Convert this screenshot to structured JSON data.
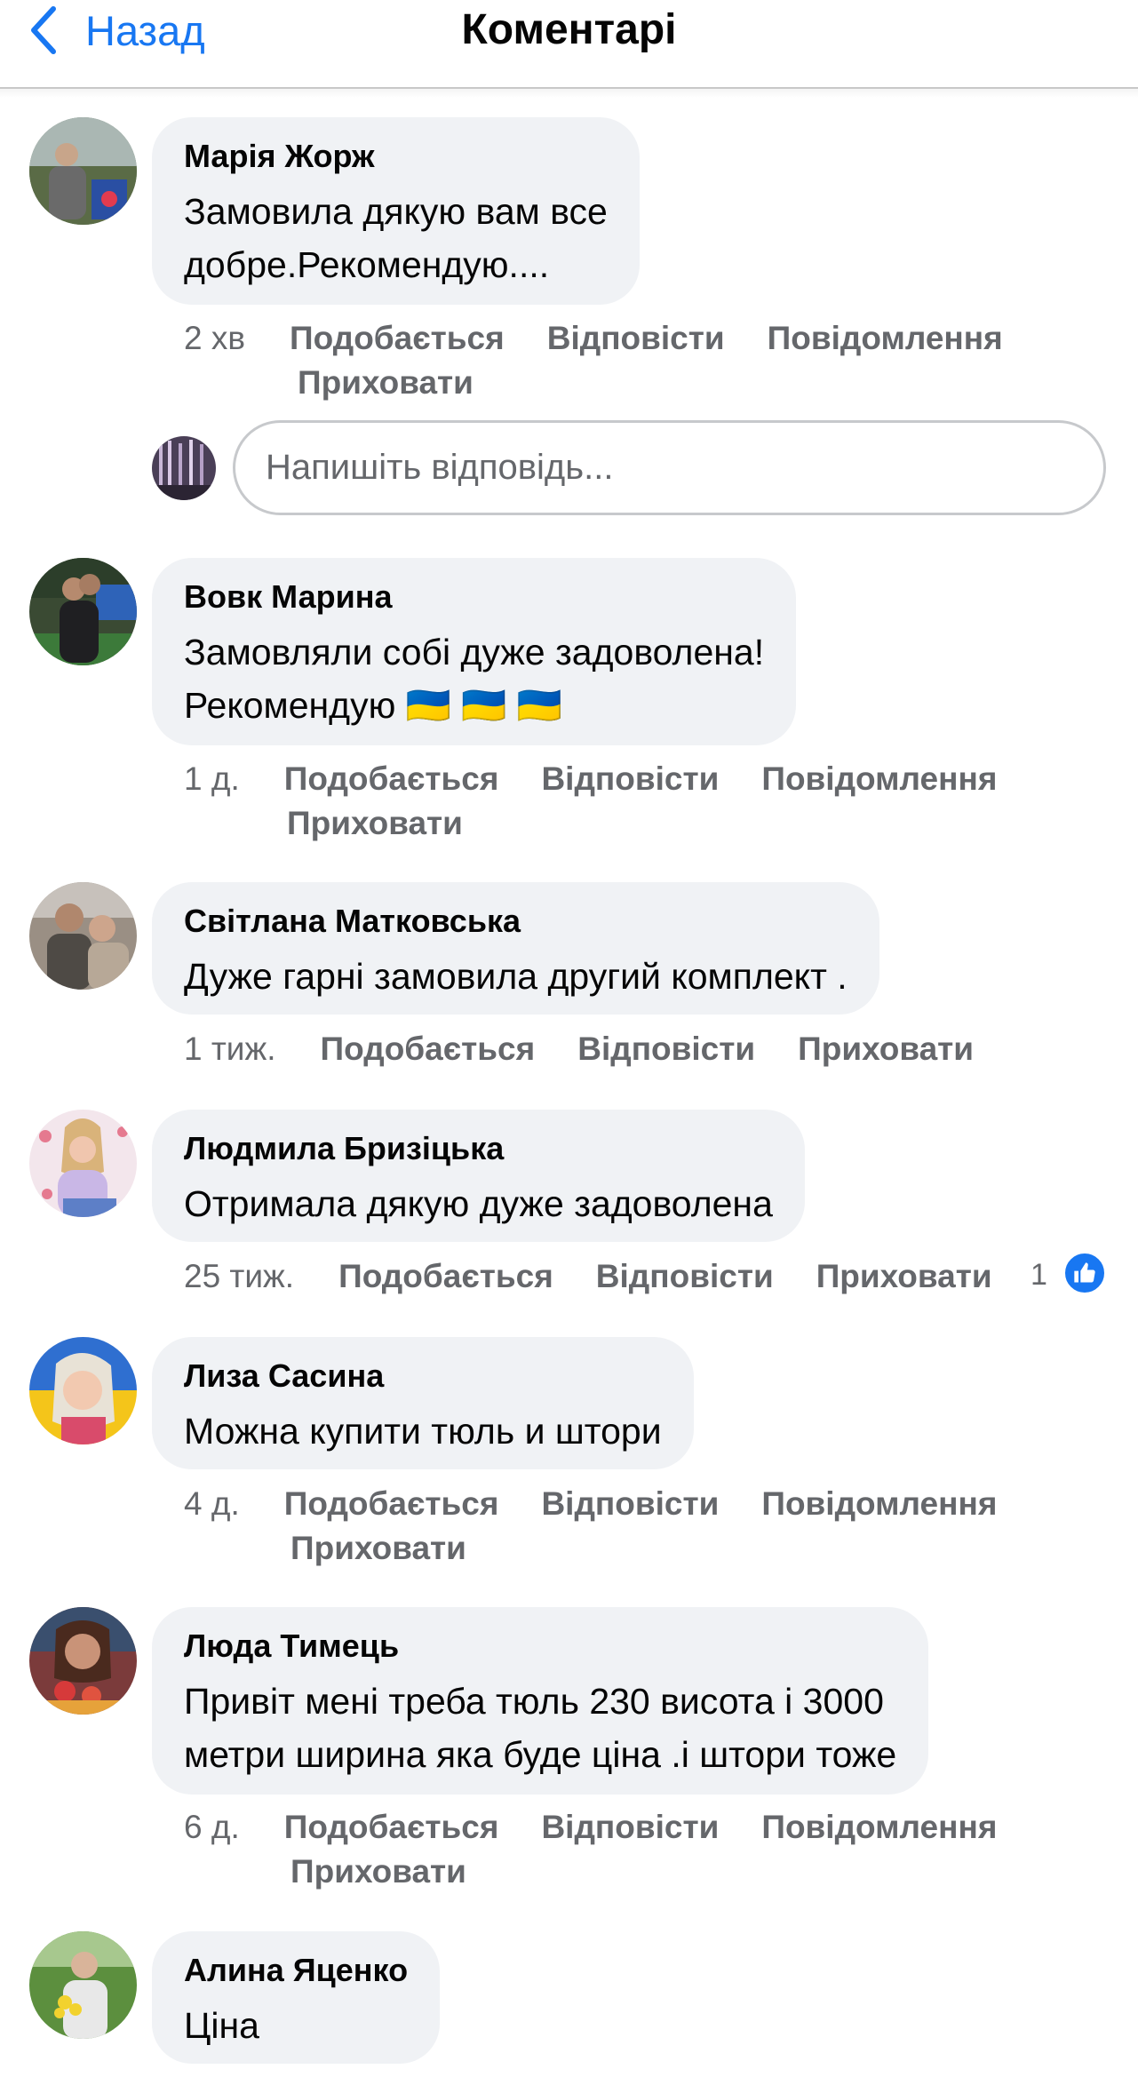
{
  "nav": {
    "back_label": "Назад",
    "title": "Коментарі"
  },
  "reply": {
    "placeholder": "Напишіть відповідь..."
  },
  "comments": [
    {
      "author": "Марія Жорж",
      "text": "Замовила дякую вам все\nдобре.Рекомендую....",
      "time": "2 хв",
      "actions": [
        "Подобається",
        "Відповісти",
        "Повідомлення"
      ],
      "actions2": [
        "Приховати"
      ]
    },
    {
      "author": "Вовк Марина",
      "text": "Замовляли собі дуже задоволена!\nРекомендую 🇺🇦 🇺🇦 🇺🇦",
      "time": "1 д.",
      "actions": [
        "Подобається",
        "Відповісти",
        "Повідомлення"
      ],
      "actions2": [
        "Приховати"
      ]
    },
    {
      "author": "Світлана Матковська",
      "text": "Дуже гарні замовила другий комплект .",
      "time": "1 тиж.",
      "actions": [
        "Подобається",
        "Відповісти",
        "Приховати"
      ],
      "actions2": []
    },
    {
      "author": "Людмила Бризіцька",
      "text": "Отримала дякую дуже задоволена",
      "time": "25 тиж.",
      "actions": [
        "Подобається",
        "Відповісти",
        "Приховати"
      ],
      "actions2": [],
      "likes": "1"
    },
    {
      "author": "Лиза Сасина",
      "text": "Можна купити тюль и штори",
      "time": "4 д.",
      "actions": [
        "Подобається",
        "Відповісти",
        "Повідомлення"
      ],
      "actions2": [
        "Приховати"
      ]
    },
    {
      "author": "Люда Тимець",
      "text": "Привіт мені треба тюль 230 висота і 3000\nметри ширина яка буде ціна .і штори тоже",
      "time": "6 д.",
      "actions": [
        "Подобається",
        "Відповісти",
        "Повідомлення"
      ],
      "actions2": [
        "Приховати"
      ]
    },
    {
      "author": "Алина Яценко",
      "text": "Ціна",
      "time": "",
      "actions": [],
      "actions2": []
    }
  ],
  "colors": {
    "accent": "#1877f2",
    "bubble": "#f0f2f5",
    "secondary_text": "#65676b"
  },
  "icons": {
    "back": "chevron-left-icon",
    "like": "thumbs-up-icon"
  }
}
